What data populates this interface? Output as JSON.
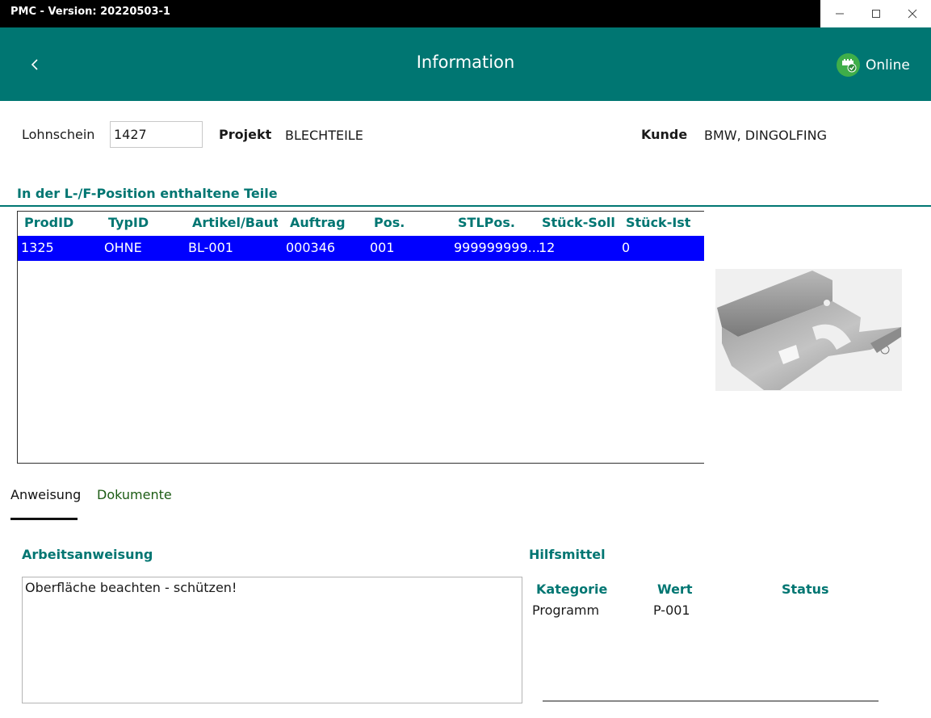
{
  "window": {
    "title": "PMC - Version: 20220503-1"
  },
  "header": {
    "title": "Information",
    "status": "Online"
  },
  "info": {
    "lohnschein_label": "Lohnschein",
    "lohnschein_value": "1427",
    "projekt_label": "Projekt",
    "projekt_value": "BLECHTEILE",
    "kunde_label": "Kunde",
    "kunde_value": "BMW, DINGOLFING"
  },
  "parts": {
    "title": "In der L-/F-Position enthaltene Teile",
    "columns": [
      "ProdID",
      "TypID",
      "Artikel/Bauteil",
      "Auftrag",
      "Pos.",
      "STLPos.",
      "Stück-Soll",
      "Stück-Ist"
    ],
    "rows": [
      [
        "1325",
        "OHNE",
        "BL-001",
        "000346",
        "001",
        "999999999...",
        "12",
        "0"
      ]
    ]
  },
  "tabs": {
    "anweisung": "Anweisung",
    "dokumente": "Dokumente"
  },
  "instruction": {
    "title": "Arbeitsanweisung",
    "text": "Oberfläche beachten - schützen!"
  },
  "tools": {
    "title": "Hilfsmittel",
    "columns": [
      "Kategorie",
      "Wert",
      "Status"
    ],
    "rows": [
      [
        "Programm",
        "P-001",
        ""
      ]
    ]
  },
  "colors": {
    "accent": "#007672",
    "selection": "#0000ff",
    "online": "#3fae49"
  },
  "icons": {
    "back": "chevron-left-icon",
    "online": "network-check-icon",
    "part": "sheet-metal-part-image"
  }
}
